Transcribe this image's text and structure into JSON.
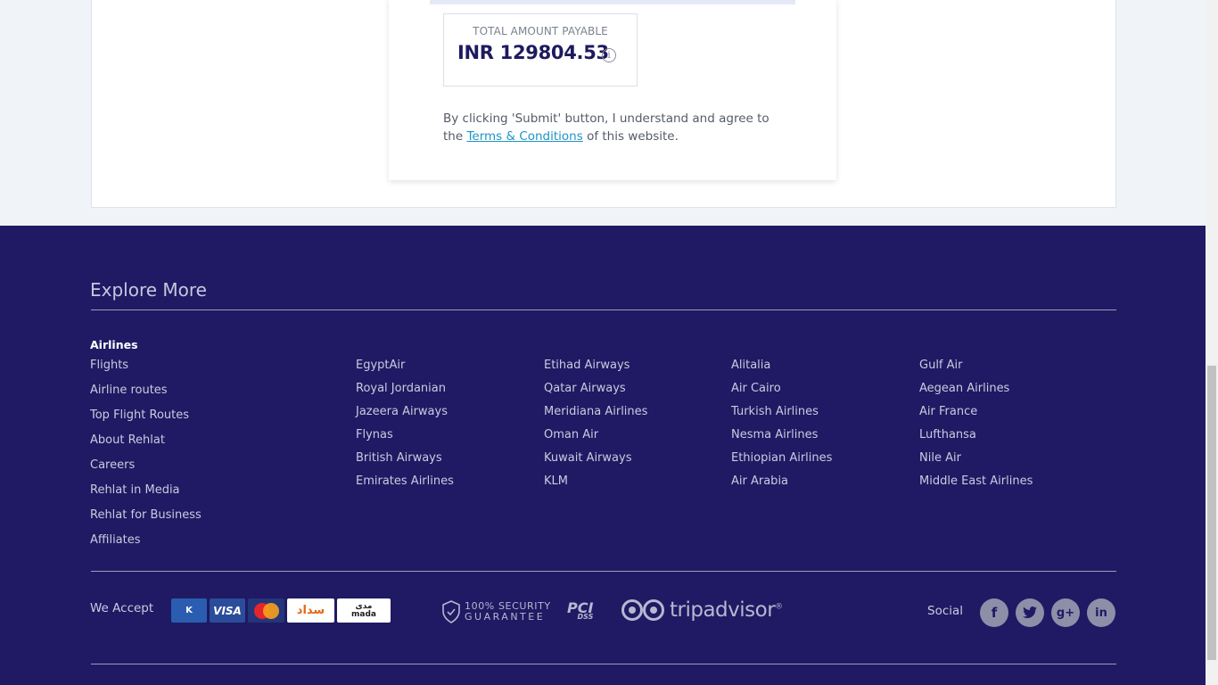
{
  "summary": {
    "total_label": "TOTAL AMOUNT PAYABLE",
    "total_value": "INR 129804.53",
    "agree_prefix": "By clicking 'Submit' button, I understand and agree to the",
    "terms_link": "Terms & Conditions",
    "agree_suffix": "of this website."
  },
  "footer": {
    "explore_title": "Explore More",
    "airlines_heading": "Airlines",
    "left_links": [
      "Flights",
      "Airline routes",
      "Top Flight Routes",
      "About Rehlat",
      "Careers",
      "Rehlat in Media",
      "Rehlat for Business",
      "Affiliates"
    ],
    "airline_columns": [
      [
        "EgyptAir",
        "Royal Jordanian",
        "Jazeera Airways",
        "Flynas",
        "British Airways",
        "Emirates Airlines"
      ],
      [
        "Etihad Airways",
        "Qatar Airways",
        "Meridiana Airlines",
        "Oman Air",
        "Kuwait Airways",
        "KLM"
      ],
      [
        "Alitalia",
        "Air Cairo",
        "Turkish Airlines",
        "Nesma Airlines",
        "Ethiopian Airlines",
        "Air Arabia"
      ],
      [
        "Gulf Air",
        "Aegean Airlines",
        "Air France",
        "Lufthansa",
        "Nile Air",
        "Middle East Airlines"
      ]
    ],
    "we_accept": "We Accept",
    "payment_cards": {
      "knet": "K",
      "visa": "VISA",
      "sadad": "سداد",
      "mada_ar": "مدى",
      "mada": "mada"
    },
    "security_line1": "100% SECURITY",
    "security_line2": "GUARANTEE",
    "pci": "PCI",
    "pci_sub": "DSS",
    "tripadvisor": "tripadvisor",
    "social_label": "Social",
    "social_icons": [
      "facebook-icon",
      "twitter-icon",
      "google-plus-icon",
      "linkedin-icon"
    ],
    "colors": {
      "footer_bg": "#1f1a63",
      "link": "#1f95c4",
      "amount": "#1e1a5e"
    }
  }
}
